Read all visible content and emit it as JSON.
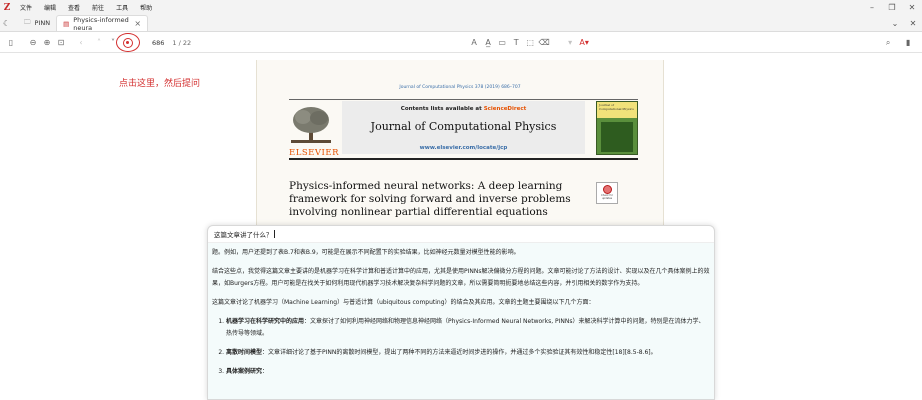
{
  "menubar": {
    "logo": "Z",
    "items": [
      "文件",
      "编辑",
      "查看",
      "前往",
      "工具",
      "帮助"
    ]
  },
  "tabs": {
    "library_label": "PINN",
    "active_label": "Physics-informed neura"
  },
  "toolbar": {
    "page_number": "686",
    "page_total": "1 / 22"
  },
  "annotation": "点击这里，然后提问",
  "pdf": {
    "citation": "Journal of Computational Physics 378 (2019) 686–707",
    "contents_prefix": "Contents lists available at ",
    "sciencedirect": "ScienceDirect",
    "journal_title": "Journal of Computational Physics",
    "journal_url": "www.elsevier.com/locate/jcp",
    "publisher": "ELSEVIER",
    "cover_text": "Journal of Computational Physics",
    "paper_title": "Physics-informed neural networks: A deep learning framework for solving forward and inverse problems involving nonlinear partial differential equations",
    "check_badge": "Check for updates"
  },
  "chat": {
    "question": "这篇文章讲了什么？",
    "p1": "题。例如，用户还提到了表B.7和表B.9，可能是在展示不同配置下的实验结果，比如神经元数量对模型性能的影响。",
    "p2": "结合这些点，我觉得这篇文章主要讲的是机器学习在科学计算和普适计算中的应用，尤其是使用PINNs解决偏微分方程的问题。文章可能讨论了方法的设计、实现以及在几个具体案例上的效果，如Burgers方程。用户可能是在找关于如何利用现代机器学习技术解决复杂科学问题的文章，所以需要简明扼要地总结这些内容，并引用相关的数字作为支持。",
    "p3": "这篇文章讨论了机器学习（Machine Learning）与普适计算（ubiquitous computing）的结合及其应用。文章的主题主要围绕以下几个方面：",
    "items": [
      {
        "bold": "机器学习在科学研究中的应用",
        "text": "：文章探讨了如何利用神经网络和物理信息神经网络（Physics-Informed Neural Networks, PINNs）来解决科学计算中的问题，特别是在流体力学、热传导等领域。"
      },
      {
        "bold": "离散时间模型",
        "text": "：文章详细讨论了基于PINN的离散时间模型，提出了两种不同的方法来逼近时间步进的操作，并通过多个实验验证其有效性和稳定性[18][8.5-8.6]。"
      },
      {
        "bold": "具体案例研究",
        "text": "："
      }
    ]
  }
}
